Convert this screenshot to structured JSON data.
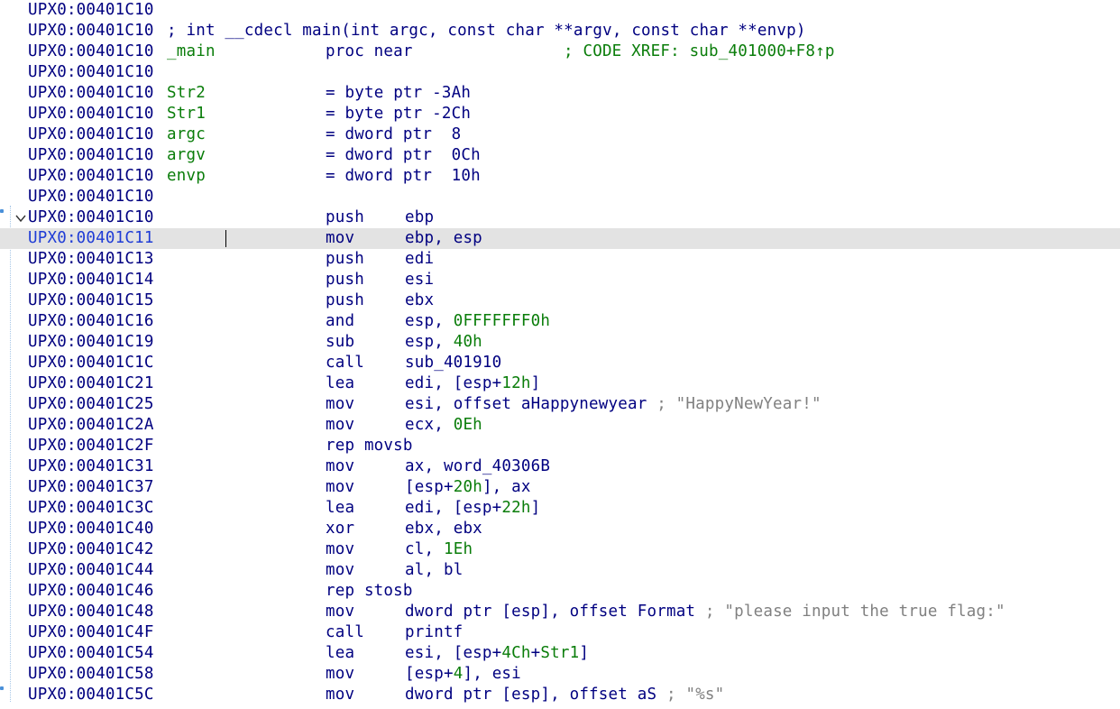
{
  "listing": {
    "rows": [
      {
        "addr": "UPX0:00401C10"
      },
      {
        "addr": "UPX0:00401C10",
        "header": "; int __cdecl main(int argc, const char **argv, const char **envp)"
      },
      {
        "addr": "UPX0:00401C10",
        "name": "_main",
        "mnem": "proc near",
        "xref": "; CODE XREF: sub_401000+F8↑p"
      },
      {
        "addr": "UPX0:00401C10"
      },
      {
        "addr": "UPX0:00401C10",
        "name": "Str2",
        "mnem": "= byte ptr -3Ah"
      },
      {
        "addr": "UPX0:00401C10",
        "name": "Str1",
        "mnem": "= byte ptr -2Ch"
      },
      {
        "addr": "UPX0:00401C10",
        "name": "argc",
        "mnem": "= dword ptr  8"
      },
      {
        "addr": "UPX0:00401C10",
        "name": "argv",
        "mnem": "= dword ptr  0Ch"
      },
      {
        "addr": "UPX0:00401C10",
        "name": "envp",
        "mnem": "= dword ptr  10h"
      },
      {
        "addr": "UPX0:00401C10"
      },
      {
        "addr": "UPX0:00401C10",
        "mnem": "push",
        "ops": "ebp"
      },
      {
        "addr": "UPX0:00401C11",
        "mnem": "mov",
        "ops": "ebp, esp"
      },
      {
        "addr": "UPX0:00401C13",
        "mnem": "push",
        "ops": "edi"
      },
      {
        "addr": "UPX0:00401C14",
        "mnem": "push",
        "ops": "esi"
      },
      {
        "addr": "UPX0:00401C15",
        "mnem": "push",
        "ops": "ebx"
      },
      {
        "addr": "UPX0:00401C16",
        "mnem": "and",
        "ops": "esp, 0FFFFFFF0h"
      },
      {
        "addr": "UPX0:00401C19",
        "mnem": "sub",
        "ops": "esp, 40h"
      },
      {
        "addr": "UPX0:00401C1C",
        "mnem": "call",
        "ops": "sub_401910"
      },
      {
        "addr": "UPX0:00401C21",
        "mnem": "lea",
        "ops": "edi, [esp+12h]"
      },
      {
        "addr": "UPX0:00401C25",
        "mnem": "mov",
        "ops": "esi, offset aHappynewyear",
        "comment": "; \"HappyNewYear!\""
      },
      {
        "addr": "UPX0:00401C2A",
        "mnem": "mov",
        "ops": "ecx, 0Eh"
      },
      {
        "addr": "UPX0:00401C2F",
        "mnem": "rep movsb"
      },
      {
        "addr": "UPX0:00401C31",
        "mnem": "mov",
        "ops": "ax, word_40306B"
      },
      {
        "addr": "UPX0:00401C37",
        "mnem": "mov",
        "ops": "[esp+20h], ax"
      },
      {
        "addr": "UPX0:00401C3C",
        "mnem": "lea",
        "ops": "edi, [esp+22h]"
      },
      {
        "addr": "UPX0:00401C40",
        "mnem": "xor",
        "ops": "ebx, ebx"
      },
      {
        "addr": "UPX0:00401C42",
        "mnem": "mov",
        "ops": "cl, 1Eh"
      },
      {
        "addr": "UPX0:00401C44",
        "mnem": "mov",
        "ops": "al, bl"
      },
      {
        "addr": "UPX0:00401C46",
        "mnem": "rep stosb"
      },
      {
        "addr": "UPX0:00401C48",
        "mnem": "mov",
        "ops": "dword ptr [esp], offset Format",
        "comment": "; \"please input the true flag:\""
      },
      {
        "addr": "UPX0:00401C4F",
        "mnem": "call",
        "ops": "printf"
      },
      {
        "addr": "UPX0:00401C54",
        "mnem": "lea",
        "ops": "esi, [esp+4Ch+Str1]"
      },
      {
        "addr": "UPX0:00401C58",
        "mnem": "mov",
        "ops": "[esp+4], esi"
      },
      {
        "addr": "UPX0:00401C5C",
        "mnem": "mov",
        "ops": "dword ptr [esp], offset aS",
        "comment": "; \"%s\""
      }
    ],
    "current_row": 11,
    "fold_row": 10,
    "gutter_dot_rows": [
      10,
      33
    ],
    "colors": {
      "address": "#000080",
      "instruction": "#000080",
      "name": "#0a7d0a",
      "number": "#0a7d0a",
      "comment": "#808080",
      "current_line_bg": "#e3e3e3",
      "current_address": "#1f3cd6"
    },
    "icons": {
      "fold": "chevron-down-icon",
      "gutter": "breakpoint-dot-icon"
    }
  }
}
